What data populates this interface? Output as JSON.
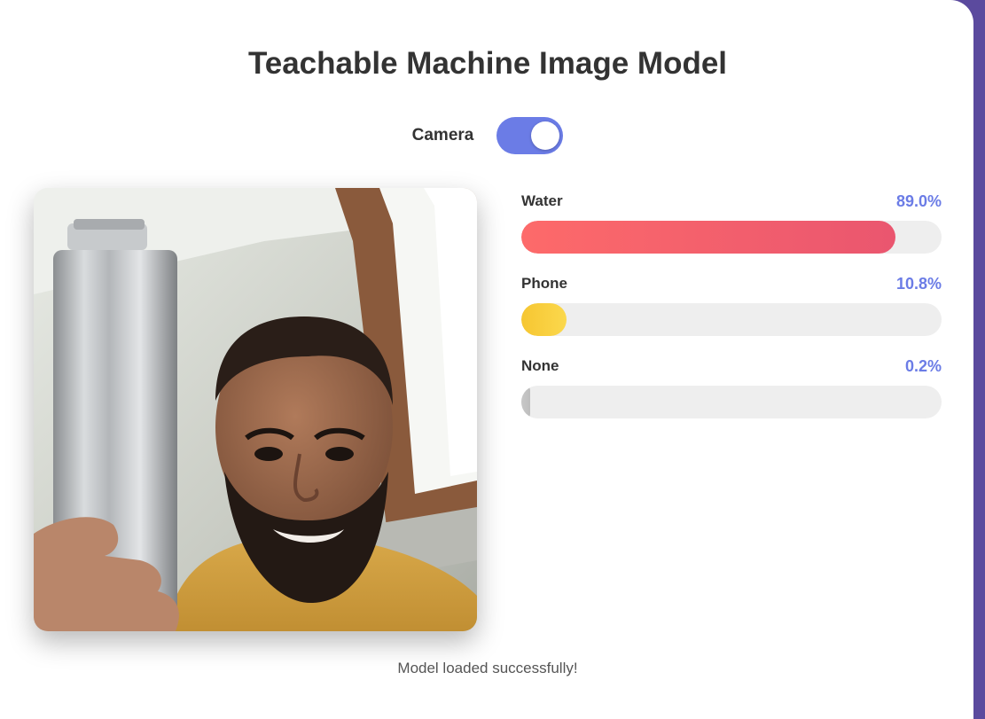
{
  "app": {
    "title": "Teachable Machine Image Model",
    "status_message": "Model loaded successfully!"
  },
  "camera": {
    "label": "Camera",
    "enabled": true,
    "toggle_color": "#6b7ce6"
  },
  "video_feed": {
    "icon": "webcam-feed"
  },
  "predictions": [
    {
      "label": "Water",
      "value_text": "89.0%",
      "value": 0.89,
      "color_start": "#fd6a6a",
      "color_end": "#ea566f"
    },
    {
      "label": "Phone",
      "value_text": "10.8%",
      "value": 0.108,
      "color_start": "#f6c631",
      "color_end": "#fbd84d"
    },
    {
      "label": "None",
      "value_text": "0.2%",
      "value": 0.002,
      "color_start": "#c8c8c8",
      "color_end": "#bdbdbd"
    }
  ],
  "colors": {
    "accent": "#6b7ce6",
    "background": "#5b4a9e",
    "track": "#eeeeee"
  }
}
